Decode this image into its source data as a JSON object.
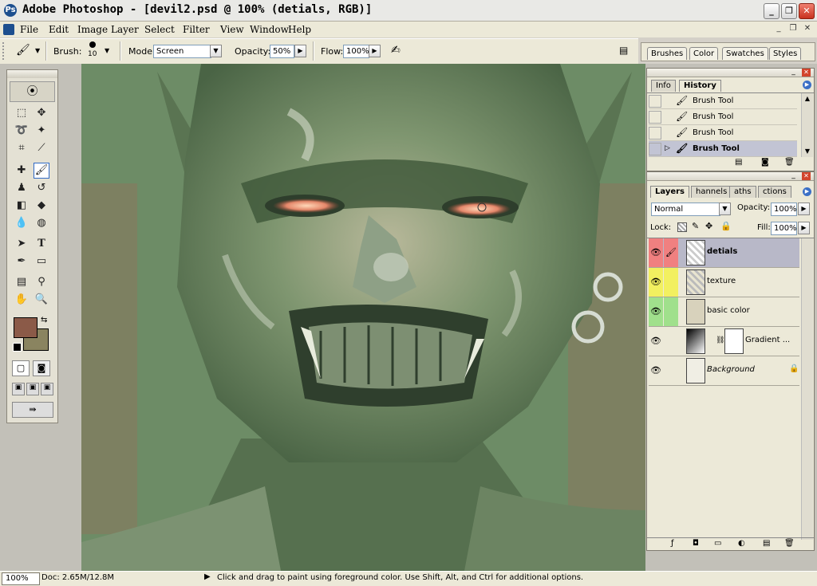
{
  "window": {
    "title": "Adobe Photoshop - [devil2.psd @ 100% (detials, RGB)]",
    "logo": "Ps"
  },
  "menu": [
    "File",
    "Edit",
    "Image",
    "Layer",
    "Select",
    "Filter",
    "View",
    "Window",
    "Help"
  ],
  "options": {
    "brush_label": "Brush:",
    "brush_size": "10",
    "mode_label": "Mode:",
    "mode_value": "Screen",
    "opacity_label": "Opacity:",
    "opacity_value": "50%",
    "flow_label": "Flow:",
    "flow_value": "100%"
  },
  "palette_well": {
    "tabs": [
      "Brushes",
      "Color",
      "Swatches",
      "Styles"
    ]
  },
  "history": {
    "tabs": [
      "Info",
      "History"
    ],
    "items": [
      {
        "label": "Brush Tool",
        "active": false
      },
      {
        "label": "Brush Tool",
        "active": false
      },
      {
        "label": "Brush Tool",
        "active": false
      },
      {
        "label": "Brush Tool",
        "active": true
      }
    ]
  },
  "layers": {
    "tabs": [
      "Layers",
      "Channels",
      "Paths",
      "Actions"
    ],
    "tab_visible": [
      "Layers",
      "hannels",
      "aths",
      "ctions"
    ],
    "blend_mode": "Normal",
    "opacity_label": "Opacity:",
    "opacity_value": "100%",
    "lock_label": "Lock:",
    "fill_label": "Fill:",
    "fill_value": "100%",
    "items": [
      {
        "name": "detials",
        "color": "#f08080",
        "selected": true,
        "style": "bold"
      },
      {
        "name": "texture",
        "color": "#f2f060",
        "selected": false,
        "style": "normal"
      },
      {
        "name": "basic color",
        "color": "#a0e08c",
        "selected": false,
        "style": "normal"
      },
      {
        "name": "Gradient ...",
        "color": "#ece9d8",
        "selected": false,
        "style": "normal"
      },
      {
        "name": "Background",
        "color": "#ece9d8",
        "selected": false,
        "style": "italic"
      }
    ]
  },
  "status": {
    "zoom": "100%",
    "doc": "Doc: 2.65M/12.8M",
    "hint": "Click and drag to paint using foreground color.  Use Shift, Alt, and Ctrl for additional options."
  },
  "colors": {
    "foreground": "#8b5a48",
    "background": "#8a8460",
    "selection_highlight": "#316ac5",
    "canvas_green": "#6c8a64"
  },
  "tools": [
    "marquee-icon",
    "move-icon",
    "lasso-icon",
    "magic-wand-icon",
    "crop-icon",
    "slice-icon",
    "healing-icon",
    "brush-icon",
    "stamp-icon",
    "history-brush-icon",
    "eraser-icon",
    "bucket-icon",
    "blur-icon",
    "dodge-icon",
    "path-select-icon",
    "type-icon",
    "pen-icon",
    "shape-icon",
    "notes-icon",
    "eyedropper-icon",
    "hand-icon",
    "zoom-icon"
  ]
}
